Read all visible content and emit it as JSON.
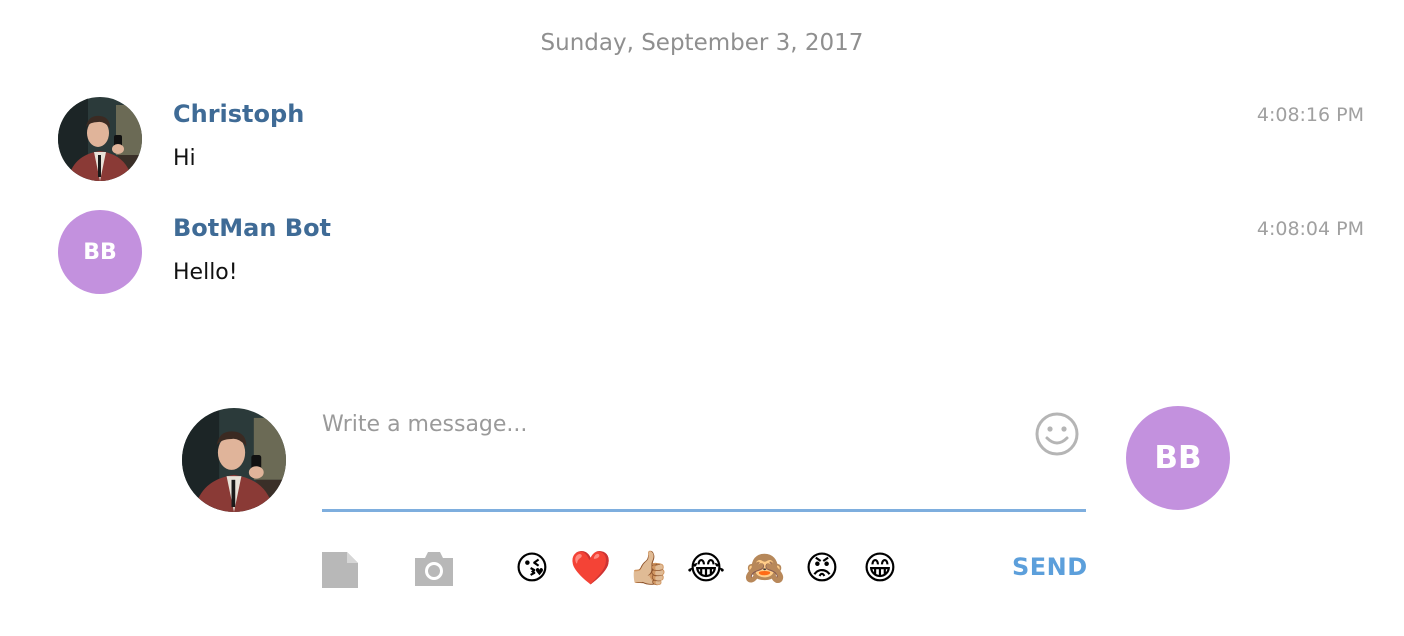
{
  "conversation": {
    "date_label": "Sunday, September 3, 2017",
    "messages": [
      {
        "author": "Christoph",
        "text": "Hi",
        "time": "4:08:16 PM"
      },
      {
        "author": "BotMan Bot",
        "text": "Hello!",
        "time": "4:08:04 PM",
        "avatar_initials": "BB"
      }
    ]
  },
  "composer": {
    "placeholder": "Write a message...",
    "bot_avatar_initials": "BB",
    "send_label": "SEND",
    "quick_emojis": [
      "😘",
      "❤️",
      "👍🏼",
      "😂",
      "🙈",
      "😡",
      "😁"
    ]
  },
  "colors": {
    "author": "#3f6b96",
    "accent": "#5c9fdb",
    "underline": "#7eaede",
    "bot_avatar": "#c391de",
    "muted": "#9a9a9a"
  },
  "icons": {
    "attach_file": "file-icon",
    "attach_photo": "camera-icon",
    "emoji_picker": "smiley-icon"
  }
}
